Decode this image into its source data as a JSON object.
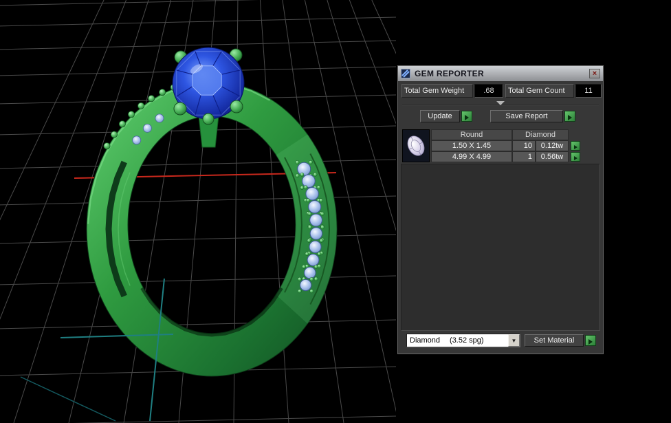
{
  "panel": {
    "title": "GEM REPORTER",
    "close_label": "×",
    "stats": {
      "weight_label": "Total Gem Weight",
      "weight_value": ".68",
      "count_label": "Total Gem Count",
      "count_value": "11"
    },
    "actions": {
      "update": "Update",
      "save_report": "Save Report",
      "set_material": "Set Material"
    },
    "material": {
      "selected": "Diamond",
      "density": "(3.52 spg)",
      "dropdown_icon": "▼"
    },
    "table": {
      "shape_header": "Round",
      "material_header": "Diamond",
      "rows": [
        {
          "size": "1.50 X 1.45",
          "count": "10",
          "weight": "0.12tw"
        },
        {
          "size": "4.99 X 4.99",
          "count": "1",
          "weight": "0.56tw"
        }
      ]
    }
  },
  "viewport": {
    "colors": {
      "background": "#000000",
      "grid": "#4a4a4a",
      "ring_green": "#2f9b40",
      "gem_blue": "#2e56e2",
      "accent_stone_blue": "#aac2ec",
      "axis_red": "#c8281c",
      "axis_teal": "#1f7f82"
    }
  }
}
